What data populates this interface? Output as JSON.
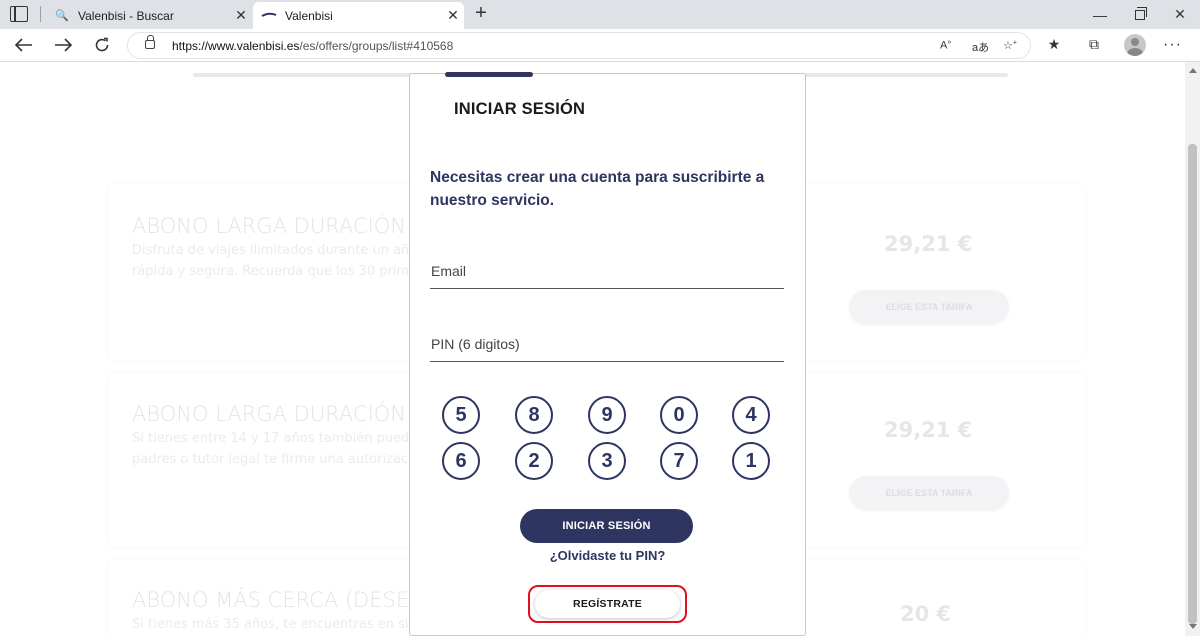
{
  "browser": {
    "tabs": [
      {
        "title": "Valenbisi - Buscar",
        "active": false,
        "favicon": "search-icon"
      },
      {
        "title": "Valenbisi",
        "active": true,
        "favicon": "valenbisi-logo-icon"
      }
    ],
    "url_host": "https://www.valenbisi.es",
    "url_path": "/es/offers/groups/list#410568"
  },
  "offers": [
    {
      "title": "ABONO LARGA DURACIÓN",
      "desc": "Disfruta de viajes ilimitados durante un año rápida y segura. Recuerda que los 30 primer",
      "price": "29,21 €",
      "button": "ELIGE ESTA TARIFA"
    },
    {
      "title": "ABONO LARGA DURACIÓN M",
      "desc": "Si tienes entre 14 y 17 años también puede padres o tutor legal te firme una autorizació",
      "price": "29,21 €",
      "button": "ELIGE ESTA TARIFA"
    },
    {
      "title": "ABONO MÁS CERCA (DESEM",
      "desc": "Si tienes más 35 años, te encuentras en sit",
      "price": "20 €",
      "button": ""
    }
  ],
  "modal": {
    "title": "INICIAR SESIÓN",
    "message": "Necesitas crear una cuenta para suscribirte a nuestro servicio.",
    "email_placeholder": "Email",
    "pin_placeholder": "PIN (6 digitos)",
    "keypad": [
      [
        "5",
        "8",
        "9",
        "0",
        "4"
      ],
      [
        "6",
        "2",
        "3",
        "7",
        "1"
      ]
    ],
    "login_button": "INICIAR SESIÓN",
    "forgot_link": "¿Olvidaste tu PIN?",
    "register_button": "REGÍSTRATE"
  },
  "colors": {
    "brand_navy": "#2d3560",
    "highlight_red": "#e01020"
  }
}
